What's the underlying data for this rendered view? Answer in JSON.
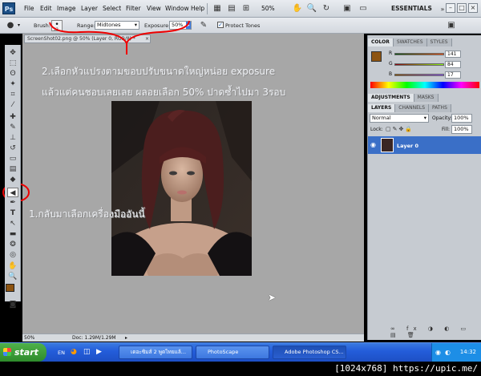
{
  "menubar": {
    "logo": "Ps",
    "items": [
      "File",
      "Edit",
      "Image",
      "Layer",
      "Select",
      "Filter",
      "View",
      "Window",
      "Help"
    ],
    "zoom": "50%",
    "workspace": "ESSENTIALS"
  },
  "options": {
    "brush_label": "Brush:",
    "brush_size": "33",
    "range_label": "Range:",
    "range_value": "Midtones",
    "exposure_label": "Exposure:",
    "exposure_value": "50%",
    "protect_label": "Protect Tones"
  },
  "document": {
    "tab_title": "ScreenShot02.png @ 50% (Layer 0, RGB/8) *",
    "zoom": "50%",
    "doc_size": "Doc: 1.29M/1.29M"
  },
  "instructions": {
    "line1": "2.เลือกหัวแปรงตามขอบปรับขนาดใหญ่หน่อย exposure",
    "line2": "แล้วแต่คนชอบเลยเลย ผลอยเลือก 50% ปาดซ้ำไปมา 3รอบ",
    "line3": "1.กลับมาเลือกเครื่องมืออันนี้"
  },
  "color_panel": {
    "tabs": [
      "COLOR",
      "SWATCHES",
      "STYLES"
    ],
    "r_label": "R",
    "r_value": "141",
    "g_label": "G",
    "g_value": "84",
    "b_label": "B",
    "b_value": "17",
    "foreground": "#8d5411"
  },
  "adjust_panel": {
    "tabs": [
      "ADJUSTMENTS",
      "MASKS"
    ]
  },
  "layers_panel": {
    "tabs": [
      "LAYERS",
      "CHANNELS",
      "PATHS"
    ],
    "blend_mode": "Normal",
    "opacity_label": "Opacity:",
    "opacity_value": "100%",
    "lock_label": "Lock:",
    "fill_label": "Fill:",
    "fill_value": "100%",
    "layer_name": "Layer 0"
  },
  "taskbar": {
    "start": "start",
    "lang": "EN",
    "tasks": [
      "เดอะซิมส์ 2 พูดไทยแล้...",
      "PhotoScape",
      "Adobe Photoshop CS..."
    ],
    "clock": "14:32"
  },
  "watermark": "[1024x768] https://upic.me/"
}
